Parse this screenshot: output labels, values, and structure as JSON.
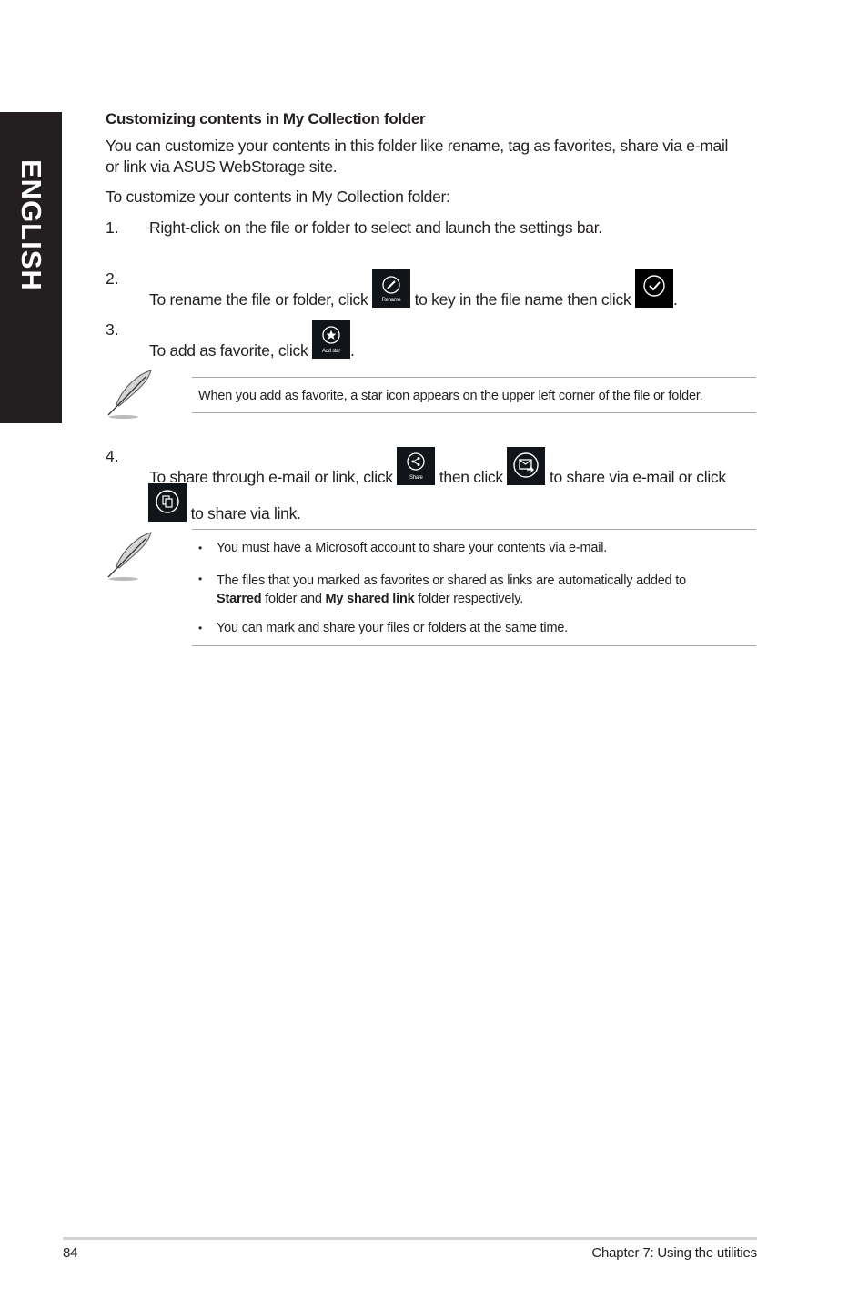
{
  "side_tab": {
    "label": "ENGLISH"
  },
  "heading": "Customizing contents in My Collection folder",
  "intro": {
    "line1": "You can customize your contents in this folder like rename, tag as favorites, share via e-mail",
    "line2": "or link via ASUS WebStorage site."
  },
  "lead": "To customize your contents in My Collection folder:",
  "steps": [
    {
      "num": "1.",
      "text": "Right-click on the file or folder to select and launch the settings bar."
    },
    {
      "num": "2.",
      "pre": "To rename the file or folder, click",
      "mid": "to key in the file name then click",
      "post": "."
    },
    {
      "num": "3.",
      "pre": "To add as favorite, click",
      "post": "."
    },
    {
      "num": "4.",
      "pre": "To share through e-mail or link, click",
      "mid": "then click",
      "mid2": "to share via e-mail or click",
      "post": "to share via link."
    }
  ],
  "icons": {
    "rename": {
      "label": "Rename",
      "icon": "pencil-icon"
    },
    "confirm": {
      "icon": "checkmark-icon"
    },
    "add_star": {
      "label": "Add star",
      "icon": "star-icon"
    },
    "share": {
      "label": "Share",
      "icon": "share-icon"
    },
    "email": {
      "icon": "email-share-icon"
    },
    "link": {
      "icon": "copy-link-icon"
    }
  },
  "note1": "When you add as favorite, a star icon appears on the upper left corner of the file or folder.",
  "note2": {
    "bullets": [
      {
        "text": "You must have a Microsoft account to share your contents via e-mail."
      },
      {
        "pre": "The files that you marked as favorites or shared as links are automatically added to",
        "bold1": "Starred",
        "mid": " folder and ",
        "bold2": "My shared link",
        "post": " folder respectively."
      },
      {
        "text": "You can mark and share your files or folders at the same time."
      }
    ]
  },
  "footer": {
    "page": "84",
    "chapter": "Chapter 7: Using the utilities"
  }
}
